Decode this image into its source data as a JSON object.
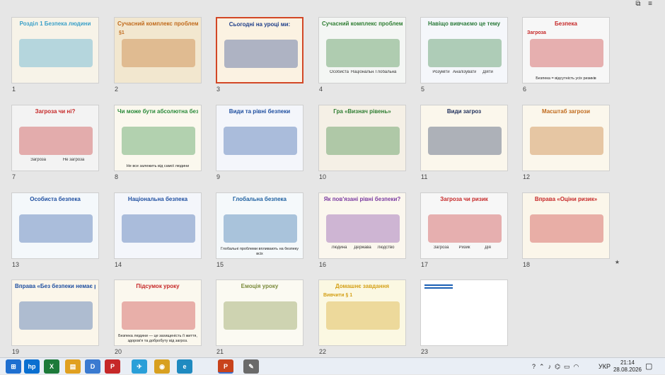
{
  "window": {
    "controls": {
      "restore": "⧉",
      "menu": "≡"
    }
  },
  "slides": [
    {
      "number": "1",
      "title": "Розділ 1 Безпека людини",
      "bg": "#f7f3e8",
      "accent": "#3aa0c8"
    },
    {
      "number": "2",
      "title": "Сучасний комплекс проблем безпеки",
      "subtitle": "§1",
      "bg": "#f2e7cf",
      "accent": "#c06a1c"
    },
    {
      "number": "3",
      "title": "Сьогодні на уроці ми:",
      "bg": "#fbf2e2",
      "accent": "#1f3f8a",
      "selected": true
    },
    {
      "number": "4",
      "title": "Сучасний комплекс проблем безпеки",
      "labels": [
        "Особиста",
        "Національна",
        "Глобальна"
      ],
      "bg": "#f4f6f4",
      "accent": "#2e7d32"
    },
    {
      "number": "5",
      "title": "Навіщо вивчаємо це тему",
      "labels": [
        "Розуміти",
        "Аналізувати",
        "Діяти"
      ],
      "bg": "#f5f7fb",
      "accent": "#2a7a3a"
    },
    {
      "number": "6",
      "title": "Безпека",
      "subtitle": "Загроза",
      "caption": "Безпека = відсутність усіх ризиків",
      "bg": "#f7f7f7",
      "accent": "#c62828"
    },
    {
      "number": "7",
      "title": "Загроза чи ні?",
      "labels": [
        "Загроза",
        "Не загроза"
      ],
      "bg": "#f3f3f3",
      "accent": "#c62828"
    },
    {
      "number": "8",
      "title": "Чи може бути абсолютна безпека?",
      "caption": "Не все залежить від самої людини",
      "bg": "#fbf8ee",
      "accent": "#2a8a3a"
    },
    {
      "number": "9",
      "title": "Види та рівні безпеки",
      "bg": "#f4f6fb",
      "accent": "#1f4fa0"
    },
    {
      "number": "10",
      "title": "Гра «Визнач рівень»",
      "bg": "#f5f0e6",
      "accent": "#2e7d32"
    },
    {
      "number": "11",
      "title": "Види загроз",
      "bg": "#fbf7ec",
      "accent": "#1d2d5a"
    },
    {
      "number": "12",
      "title": "Масштаб загрози",
      "bg": "#fbf7ec",
      "accent": "#c06a1c"
    },
    {
      "number": "13",
      "title": "Особиста безпека",
      "bg": "#f4f8fb",
      "accent": "#1f4fa0"
    },
    {
      "number": "14",
      "title": "Національна безпека",
      "bg": "#f4f6fb",
      "accent": "#1f4fa0"
    },
    {
      "number": "15",
      "title": "Глобальна безпека",
      "caption": "Глобальні проблеми впливають на безпеку всіх",
      "bg": "#f5f9fb",
      "accent": "#1d5fa0"
    },
    {
      "number": "16",
      "title": "Як пов'язані рівні безпеки?",
      "labels": [
        "Людина",
        "Держава",
        "Людство"
      ],
      "bg": "#fbf7ee",
      "accent": "#7a3aa0"
    },
    {
      "number": "17",
      "title": "Загроза чи ризик",
      "labels": [
        "Загроза",
        "Ризик",
        "Дія"
      ],
      "bg": "#f7f7f7",
      "accent": "#c62828"
    },
    {
      "number": "18",
      "title": "Вправа «Оціни ризик»",
      "bg": "#fbf6ea",
      "accent": "#c62828",
      "starred": true
    },
    {
      "number": "19",
      "title": "Вправа «Без безпеки немає розвитку»",
      "bg": "#fbf6ea",
      "accent": "#1f4fa0"
    },
    {
      "number": "20",
      "title": "Підсумок уроку",
      "caption": "Безпека людини — це захищеність її життя, здоров'я та добробуту від загроз.",
      "bg": "#fbf8ee",
      "accent": "#c62828"
    },
    {
      "number": "21",
      "title": "Емоція уроку",
      "bg": "#fbfaf2",
      "accent": "#7a8a3a"
    },
    {
      "number": "22",
      "title": "Домашнє завдання",
      "subtitle": "Вивчити § 1",
      "bg": "#fbf8e2",
      "accent": "#d4a017"
    },
    {
      "number": "23",
      "title": "",
      "bg": "#ffffff",
      "accent": "#1a5fb4"
    }
  ],
  "taskbar": {
    "apps": [
      {
        "name": "windows-start",
        "label": "⊞"
      },
      {
        "name": "hp",
        "label": "hp"
      },
      {
        "name": "excel",
        "label": "X"
      },
      {
        "name": "file-explorer",
        "label": "▤"
      },
      {
        "name": "document",
        "label": "D"
      },
      {
        "name": "pdf",
        "label": "P"
      },
      {
        "name": "telegram",
        "label": "✈"
      },
      {
        "name": "chrome",
        "label": "◉"
      },
      {
        "name": "edge",
        "label": "e"
      },
      {
        "name": "powerpoint",
        "label": "P"
      },
      {
        "name": "notes",
        "label": "✎"
      }
    ],
    "tray": {
      "language": "УКР",
      "time": "21:14",
      "date": "28.08.2026"
    }
  }
}
